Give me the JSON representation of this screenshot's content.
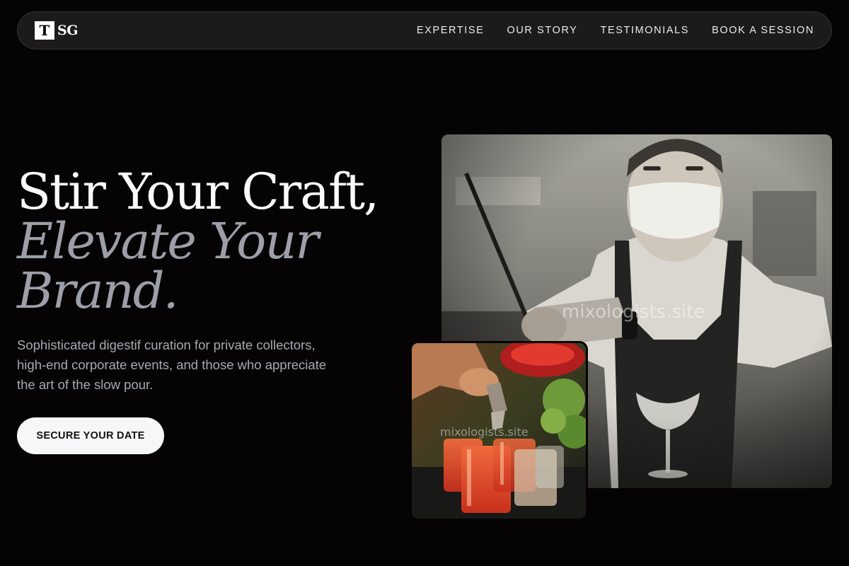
{
  "logo": {
    "box_letter": "T",
    "text": "SG"
  },
  "nav": {
    "items": [
      "EXPERTISE",
      "OUR STORY",
      "TESTIMONIALS",
      "BOOK A SESSION"
    ]
  },
  "hero": {
    "line1": "Stir Your Craft,",
    "line2": "Elevate Your",
    "line3": "Brand.",
    "subtitle": "Sophisticated digestif curation for private collectors, high-end corporate events, and those who appreciate the art of the slow pour.",
    "cta": "SECURE YOUR DATE"
  },
  "images": {
    "main_watermark": "mixologists.site",
    "small_watermark": "mixologists.site"
  },
  "colors": {
    "background": "#050304",
    "nav_bg": "#1c1a1b",
    "headline_muted": "#9c9ea8",
    "cta_bg": "#f7f7f9"
  }
}
